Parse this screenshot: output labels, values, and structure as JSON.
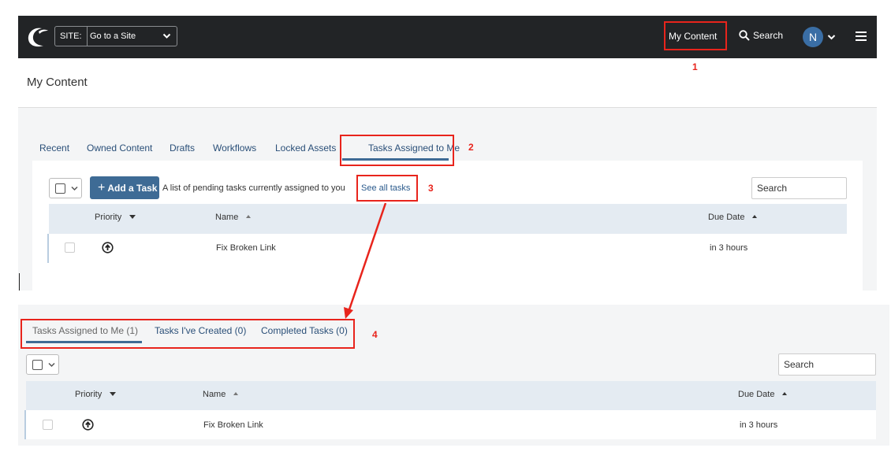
{
  "topbar": {
    "site_label": "SITE:",
    "site_value": "Go to a Site",
    "my_content": "My Content",
    "search": "Search",
    "avatar_initial": "N"
  },
  "page": {
    "title": "My Content"
  },
  "panel1": {
    "tabs": [
      "Recent",
      "Owned Content",
      "Drafts",
      "Workflows",
      "Locked Assets",
      "Tasks Assigned to Me"
    ],
    "active_tab": "Tasks Assigned to Me",
    "add_task": "Add a Task",
    "pending_text": "A list of pending tasks currently assigned to you",
    "see_all": "See all tasks",
    "search_placeholder": "Search",
    "columns": {
      "priority": "Priority",
      "name": "Name",
      "due": "Due Date"
    },
    "rows": [
      {
        "name": "Fix Broken Link",
        "due": "in 3 hours",
        "priority_icon": "arrow-up-circle-icon"
      }
    ]
  },
  "panel2": {
    "tabs": [
      "Tasks Assigned to Me (1)",
      "Tasks I've Created (0)",
      "Completed Tasks (0)"
    ],
    "active_tab": "Tasks Assigned to Me (1)",
    "search_placeholder": "Search",
    "columns": {
      "priority": "Priority",
      "name": "Name",
      "due": "Due Date"
    },
    "rows": [
      {
        "name": "Fix Broken Link",
        "due": "in 3 hours",
        "priority_icon": "arrow-up-circle-icon"
      }
    ]
  },
  "annotations": {
    "n1": "1",
    "n2": "2",
    "n3": "3",
    "n4": "4"
  },
  "colors": {
    "accent": "#3e6b95",
    "topbar": "#222426",
    "annotation": "#e8241c",
    "table_header": "#e4ebf2"
  }
}
